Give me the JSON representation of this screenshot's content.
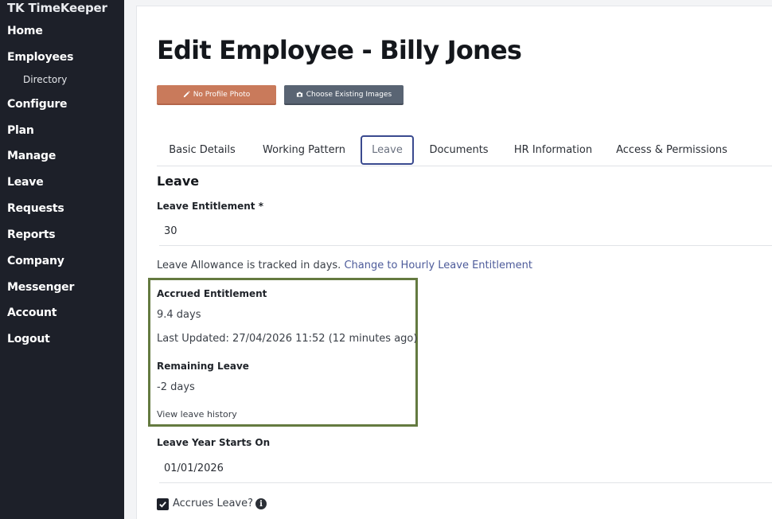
{
  "sidebar": {
    "brand": "TK TimeKeeper",
    "items": [
      {
        "label": "Home"
      },
      {
        "label": "Employees"
      },
      {
        "label": "Directory"
      },
      {
        "label": "Configure"
      },
      {
        "label": "Plan"
      },
      {
        "label": "Manage"
      },
      {
        "label": "Leave"
      },
      {
        "label": "Requests"
      },
      {
        "label": "Reports"
      },
      {
        "label": "Company"
      },
      {
        "label": "Messenger"
      },
      {
        "label": "Account"
      },
      {
        "label": "Logout"
      }
    ]
  },
  "page": {
    "title": "Edit Employee - Billy Jones",
    "no_photo_label": "No Profile Photo",
    "choose_images_label": "Choose Existing Images"
  },
  "tabs": [
    {
      "label": "Basic Details"
    },
    {
      "label": "Working Pattern"
    },
    {
      "label": "Leave"
    },
    {
      "label": "Documents"
    },
    {
      "label": "HR Information"
    },
    {
      "label": "Access & Permissions"
    }
  ],
  "leave": {
    "section_title": "Leave",
    "entitlement_label": "Leave Entitlement *",
    "entitlement_value": "30",
    "tracked_text": "Leave Allowance is tracked in days.",
    "change_link": "Change to Hourly Leave Entitlement",
    "accrued_label": "Accrued Entitlement",
    "accrued_value": "9.4 days",
    "last_updated": "Last Updated: 27/04/2026 11:52 (12 minutes ago)",
    "remaining_label": "Remaining Leave",
    "remaining_value": "-2 days",
    "history_link": "View leave history",
    "year_start_label": "Leave Year Starts On",
    "year_start_value": "01/01/2026",
    "accrues_label": "Accrues Leave?"
  },
  "colors": {
    "sidebar_bg": "#1d2029",
    "photo_button": "#c97a5b",
    "images_button": "#596473",
    "highlight_border": "#647a40",
    "active_tab_border": "#3a4a8f"
  }
}
